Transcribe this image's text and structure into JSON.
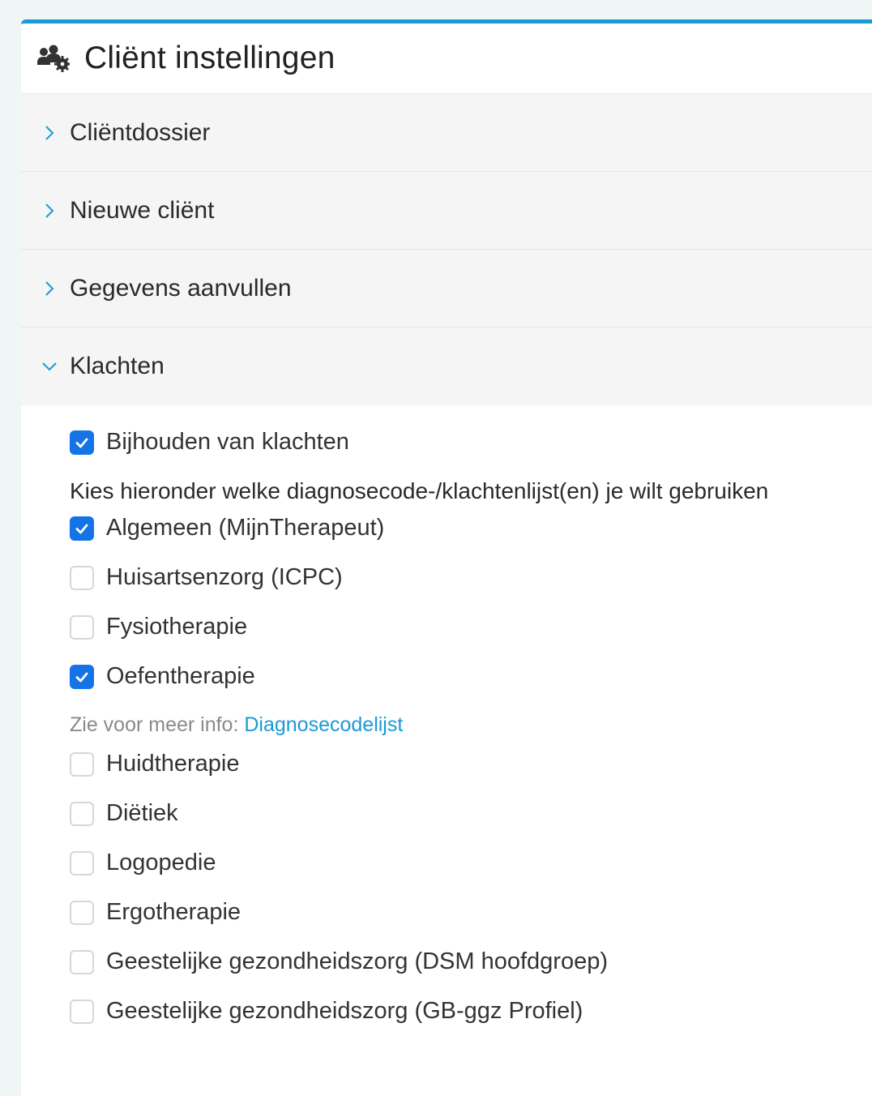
{
  "card": {
    "title": "Cliënt instellingen",
    "icon": "users-cog-icon"
  },
  "sections": [
    {
      "label": "Cliëntdossier",
      "open": false
    },
    {
      "label": "Nieuwe cliënt",
      "open": false
    },
    {
      "label": "Gegevens aanvullen",
      "open": false
    },
    {
      "label": "Klachten",
      "open": true
    }
  ],
  "klachten": {
    "track_label": "Bijhouden van klachten",
    "track_checked": true,
    "subheading": "Kies hieronder welke diagnosecode-/klachtenlijst(en) je wilt gebruiken",
    "lists_a": [
      {
        "label": "Algemeen (MijnTherapeut)",
        "checked": true
      },
      {
        "label": "Huisartsenzorg (ICPC)",
        "checked": false
      },
      {
        "label": "Fysiotherapie",
        "checked": false
      },
      {
        "label": "Oefentherapie",
        "checked": true
      }
    ],
    "info_prefix": "Zie voor meer info: ",
    "info_link": "Diagnosecodelijst",
    "lists_b": [
      {
        "label": "Huidtherapie",
        "checked": false
      },
      {
        "label": "Diëtiek",
        "checked": false
      },
      {
        "label": "Logopedie",
        "checked": false
      },
      {
        "label": "Ergotherapie",
        "checked": false
      },
      {
        "label": "Geestelijke gezondheidszorg (DSM hoofdgroep)",
        "checked": false
      },
      {
        "label": "Geestelijke gezondheidszorg (GB-ggz Profiel)",
        "checked": false
      }
    ]
  },
  "colors": {
    "accent": "#1a9ad6",
    "checkbox_checked": "#1474e6"
  }
}
